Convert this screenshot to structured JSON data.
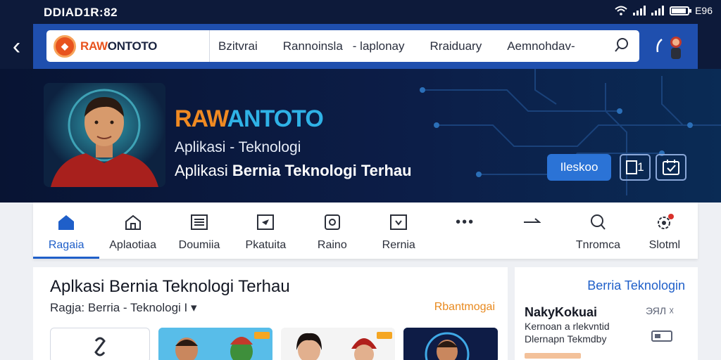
{
  "status_bar": {
    "time": "DDIAD1R:82",
    "battery": "E96"
  },
  "top_nav": {
    "logo_text_a": "RAW",
    "logo_text_b": "ONTOTO",
    "links": [
      "Bzitvrai",
      "Rannoinsla",
      "- laplonay",
      "Rraiduary",
      "Aemnohdav-"
    ]
  },
  "hero": {
    "brand_a": "RAW",
    "brand_b": "ANTOTO",
    "subtitle": "Aplikasi - Teknologi",
    "tagline_a": "Aplikasi ",
    "tagline_b": "Bernia Teknologi Terhau",
    "button_label": "Ileskoo",
    "icon_button_label": "1"
  },
  "tabs": [
    {
      "label": "Ragaia",
      "icon": "home-icon"
    },
    {
      "label": "Aplaotiaa",
      "icon": "house-outline-icon"
    },
    {
      "label": "Doumiia",
      "icon": "document-icon"
    },
    {
      "label": "Pkatuita",
      "icon": "send-box-icon"
    },
    {
      "label": "Raino",
      "icon": "badge-icon"
    },
    {
      "label": "Rernia",
      "icon": "download-box-icon"
    },
    {
      "label": "",
      "icon": "more-icon"
    },
    {
      "label": "",
      "icon": "arrow-icon"
    },
    {
      "label": "Tnromca",
      "icon": "search-icon"
    },
    {
      "label": "Slotml",
      "icon": "settings-notification-icon"
    }
  ],
  "main": {
    "title": "Aplkasi Bernia Teknologi Terhau",
    "subtitle": "Ragja: Berria - Teknologi I",
    "link": "Rbantmogai"
  },
  "side": {
    "heading": "Berria Teknologin",
    "title": "NakyKokuai",
    "line1": "Kernoan a rlekvntid",
    "line2": "Dlernapn Tekmdby",
    "icon_text": "ЭЯЛ ☓"
  },
  "colors": {
    "accent": "#1f5fc9",
    "brand_orange": "#e8531e",
    "nav_blue": "#1f4fae",
    "hero_dark": "#081433"
  }
}
